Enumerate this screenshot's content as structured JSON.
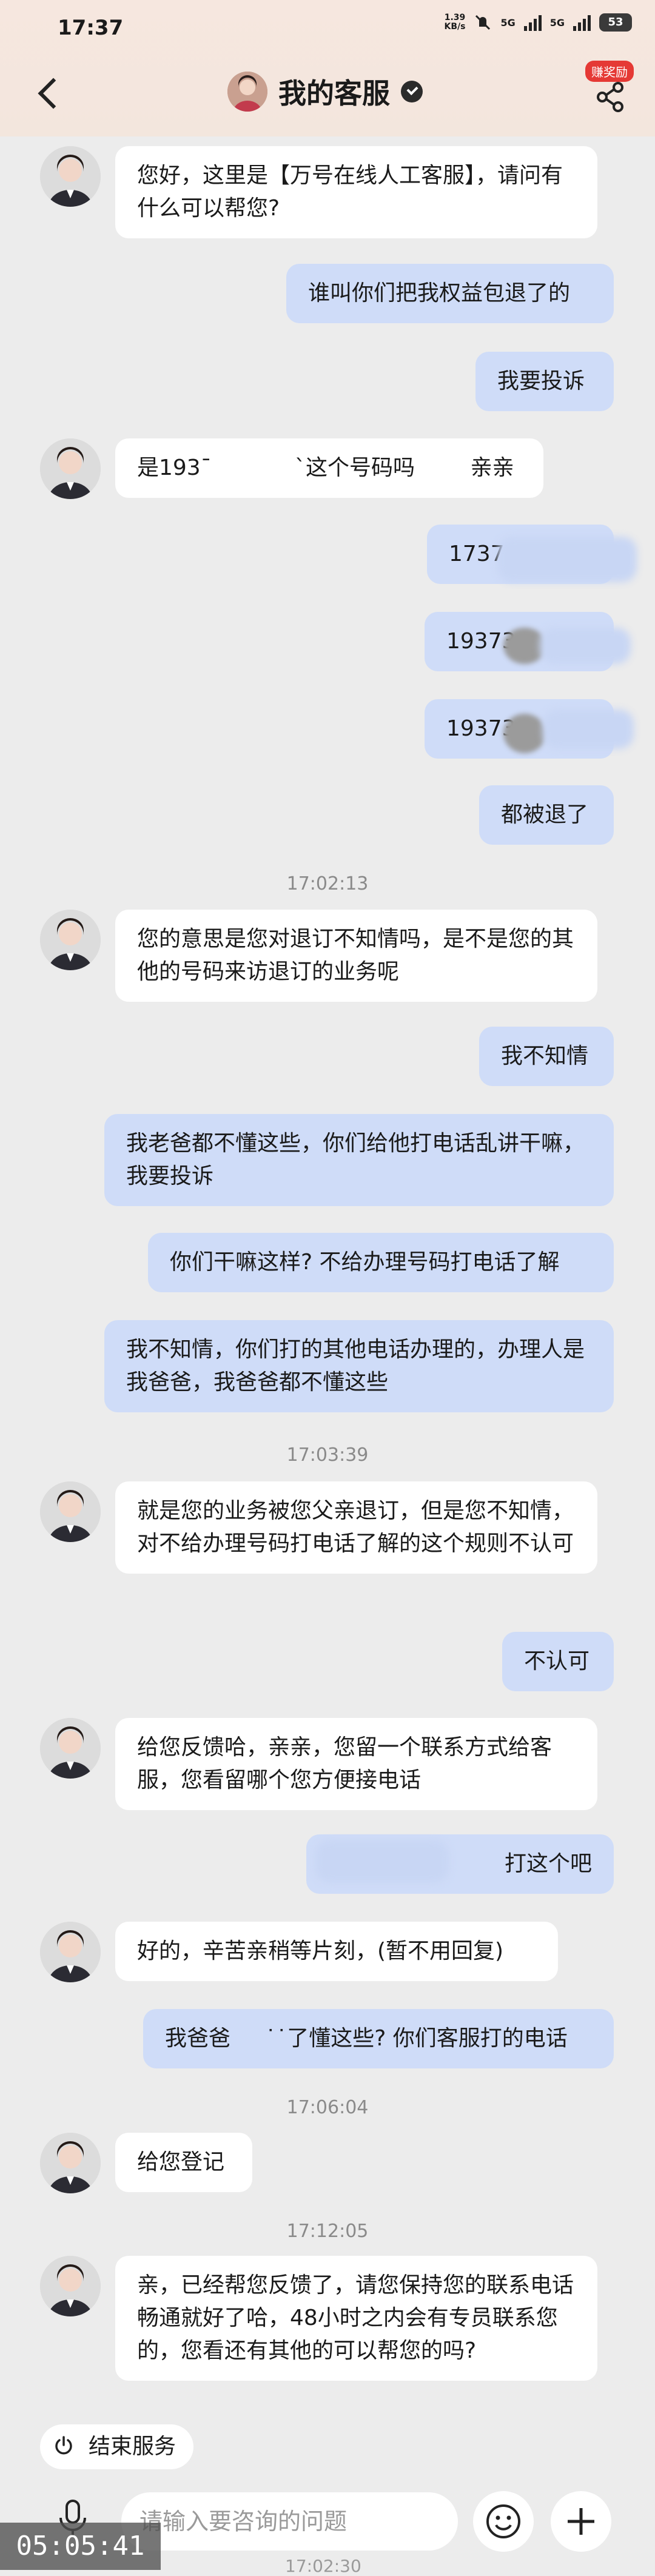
{
  "status_bar": {
    "time": "17:37",
    "net_speed": "1.39",
    "net_unit": "KB/s",
    "signal_1": "5G",
    "signal_2": "5G",
    "battery": "53"
  },
  "header": {
    "title": "我的客服",
    "badge": "赚奖励"
  },
  "messages": [
    {
      "side": "left",
      "text": "您好，这里是【万号在线人工客服】，请问有什么可以帮您?"
    },
    {
      "side": "right",
      "text": "谁叫你们把我权益包退了的"
    },
    {
      "side": "right",
      "text": "我要投诉"
    },
    {
      "side": "left",
      "text": "是193ˉ            `这个号码吗        亲亲"
    },
    {
      "side": "right",
      "text": "1737"
    },
    {
      "side": "right",
      "text": "19373"
    },
    {
      "side": "right",
      "text": "19373"
    },
    {
      "side": "right",
      "text": "都被退了"
    },
    {
      "side": "left",
      "text": "您的意思是您对退订不知情吗，是不是您的其他的号码来访退订的业务呢"
    },
    {
      "side": "right",
      "text": "我不知情"
    },
    {
      "side": "right",
      "text": "我老爸都不懂这些，你们给他打电话乱讲干嘛，我要投诉"
    },
    {
      "side": "right",
      "text": "你们干嘛这样? 不给办理号码打电话了解"
    },
    {
      "side": "right",
      "text": "我不知情，你们打的其他电话办理的，办理人是我爸爸，我爸爸都不懂这些"
    },
    {
      "side": "left",
      "text": "就是您的业务被您父亲退订，但是您不知情，对不给办理号码打电话了解的这个规则不认可"
    },
    {
      "side": "right",
      "text": "不认可"
    },
    {
      "side": "left",
      "text": "给您反馈哈，亲亲，您留一个联系方式给客服，您看留哪个您方便接电话"
    },
    {
      "side": "right",
      "text": "打这个吧"
    },
    {
      "side": "left",
      "text": "好的，辛苦亲稍等片刻，(暂不用回复)"
    },
    {
      "side": "right",
      "text": "我爸爸     ˙˙了懂这些? 你们客服打的电话"
    },
    {
      "side": "left",
      "text": "给您登记"
    },
    {
      "side": "left",
      "text": "亲，已经帮您反馈了，请您保持您的联系电话畅通就好了哈，48小时之内会有专员联系您的，您看还有其他的可以帮您的吗?"
    }
  ],
  "timestamps": [
    "17:02:13",
    "17:03:39",
    "17:06:04",
    "17:12:05"
  ],
  "end_service_label": "结束服务",
  "input_placeholder": "请输入要咨询的问题",
  "recording_overlay": "05:05:41",
  "trailing_timestamp": "17:02:30"
}
